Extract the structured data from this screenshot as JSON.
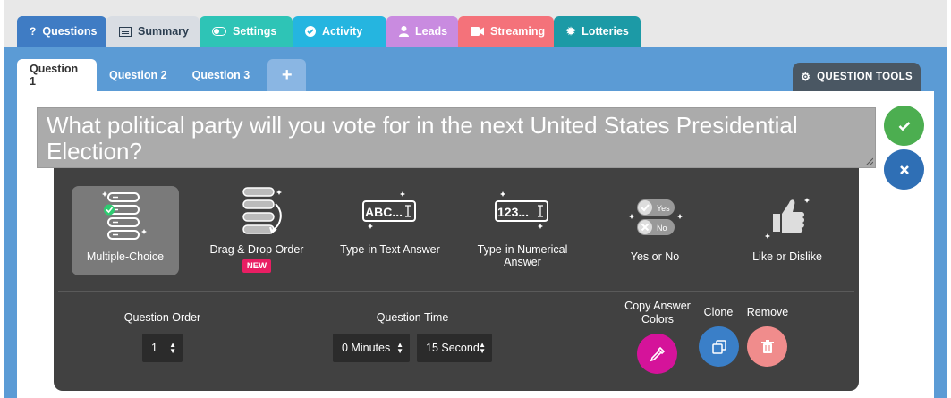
{
  "main_tabs": [
    {
      "label": "Questions",
      "icon": "question-icon"
    },
    {
      "label": "Summary",
      "icon": "list-icon"
    },
    {
      "label": "Settings",
      "icon": "toggle-icon"
    },
    {
      "label": "Activity",
      "icon": "check-circle-icon"
    },
    {
      "label": "Leads",
      "icon": "user-icon"
    },
    {
      "label": "Streaming",
      "icon": "video-camera-icon"
    },
    {
      "label": "Lotteries",
      "icon": "gear-icon"
    }
  ],
  "question_tabs": [
    "Question 1",
    "Question 2",
    "Question 3"
  ],
  "add_question_label": "+",
  "question_tools_label": "QUESTION TOOLS",
  "question_text": "What political party will you vote for in the next United States Presidential Election?",
  "question_types": [
    {
      "label": "Multiple-Choice",
      "selected": true
    },
    {
      "label": "Drag & Drop Order",
      "badge": "NEW"
    },
    {
      "label": "Type-in Text Answer",
      "icon_text": "ABC..."
    },
    {
      "label": "Type-in Numerical Answer",
      "icon_text": "123..."
    },
    {
      "label": "Yes or No",
      "yes": "Yes",
      "no": "No"
    },
    {
      "label": "Like or Dislike"
    }
  ],
  "controls": {
    "order_label": "Question Order",
    "order_value": "1",
    "time_label": "Question Time",
    "minutes_value": "0 Minutes",
    "seconds_value": "15 Seconds",
    "copy_colors_label": "Copy Answer Colors",
    "clone_label": "Clone",
    "remove_label": "Remove"
  },
  "colors": {
    "questions_tab": "#3f7cc4",
    "settings_tab": "#2ec4b6",
    "activity_tab": "#25b5e0",
    "leads_tab": "#c98be0",
    "streaming_tab": "#f4727a",
    "lotteries_tab": "#1c9aa6",
    "confirm": "#4cae50",
    "cancel": "#2f6fb5",
    "copy_colors": "#d5139a",
    "clone": "#3a7fc8",
    "remove": "#f08c8c"
  }
}
